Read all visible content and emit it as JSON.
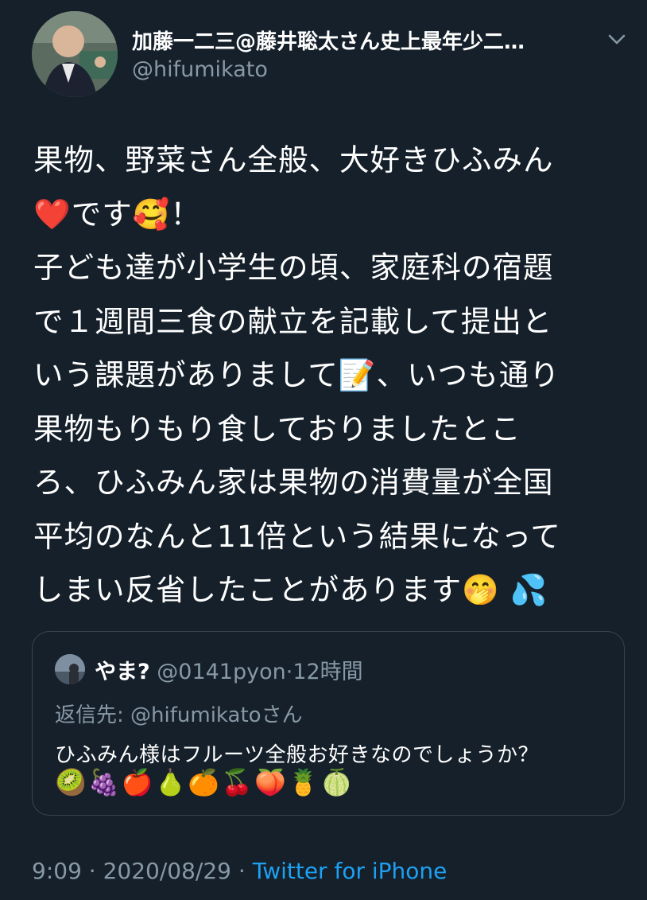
{
  "author": {
    "name": "加藤一二三@藤井聡太さん史上最年少二…",
    "handle": "@hifumikato"
  },
  "tweet": {
    "lines": [
      "果物、野菜さん全般、大好きひふみん",
      "❤️です🥰！",
      "子ども達が小学生の頃、家庭科の宿題",
      "で１週間三食の献立を記載して提出と",
      "いう課題がありまして📝、いつも通り",
      "果物もりもり食しておりましたとこ",
      "ろ、ひふみん家は果物の消費量が全国",
      "平均のなんと11倍という結果になって",
      "しまい反省したことがあります🤭 💦"
    ]
  },
  "quoted": {
    "name": "やま?",
    "handle": "@0141pyon",
    "time": "12時間",
    "reply_prefix": "返信先: ",
    "reply_to": "@hifumikato",
    "reply_suffix": "さん",
    "text": "ひふみん様はフルーツ全般お好きなのでしょうか？",
    "fruits": "🥝🍇🍎🍐🍊🍒🍑🍍🍈"
  },
  "footer": {
    "time": "9:09",
    "date": "2020/08/29",
    "source": "Twitter for iPhone"
  },
  "icons": {
    "caret": "chevron-down-icon"
  },
  "colors": {
    "background": "#15202b",
    "secondary_text": "#8899a6",
    "link": "#1da1f2",
    "border": "#38444d"
  }
}
